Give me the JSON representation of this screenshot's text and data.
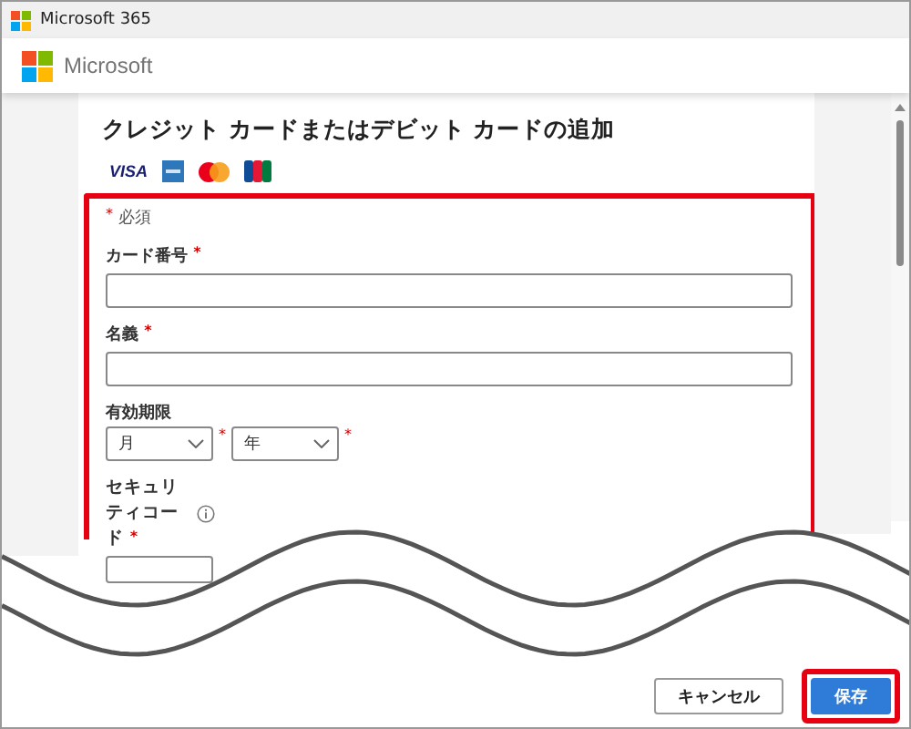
{
  "window": {
    "title": "Microsoft 365"
  },
  "brand": "Microsoft",
  "heading": "クレジット カードまたはデビット カードの追加",
  "card_logos": [
    {
      "kind": "visa",
      "label": "VISA"
    },
    {
      "kind": "amex"
    },
    {
      "kind": "mastercard"
    },
    {
      "kind": "jcb"
    }
  ],
  "form": {
    "highlighted": true,
    "required_mark": "*",
    "required_note": "必須",
    "fields": [
      {
        "kind": "text",
        "label": "カード番号",
        "required_mark": "*"
      },
      {
        "kind": "text",
        "label": "名義",
        "required_mark": "*"
      },
      {
        "kind": "expiry",
        "label": "有効期限",
        "selects": [
          {
            "placeholder": "月",
            "required_mark": "*"
          },
          {
            "placeholder": "年",
            "required_mark": "*"
          }
        ]
      },
      {
        "kind": "code",
        "label": "セキュリティコード",
        "required_mark": "*",
        "info": true
      }
    ]
  },
  "buttons": [
    {
      "label": "キャンセル",
      "primary": false,
      "highlighted": false
    },
    {
      "label": "保存",
      "primary": true,
      "highlighted": true
    }
  ]
}
